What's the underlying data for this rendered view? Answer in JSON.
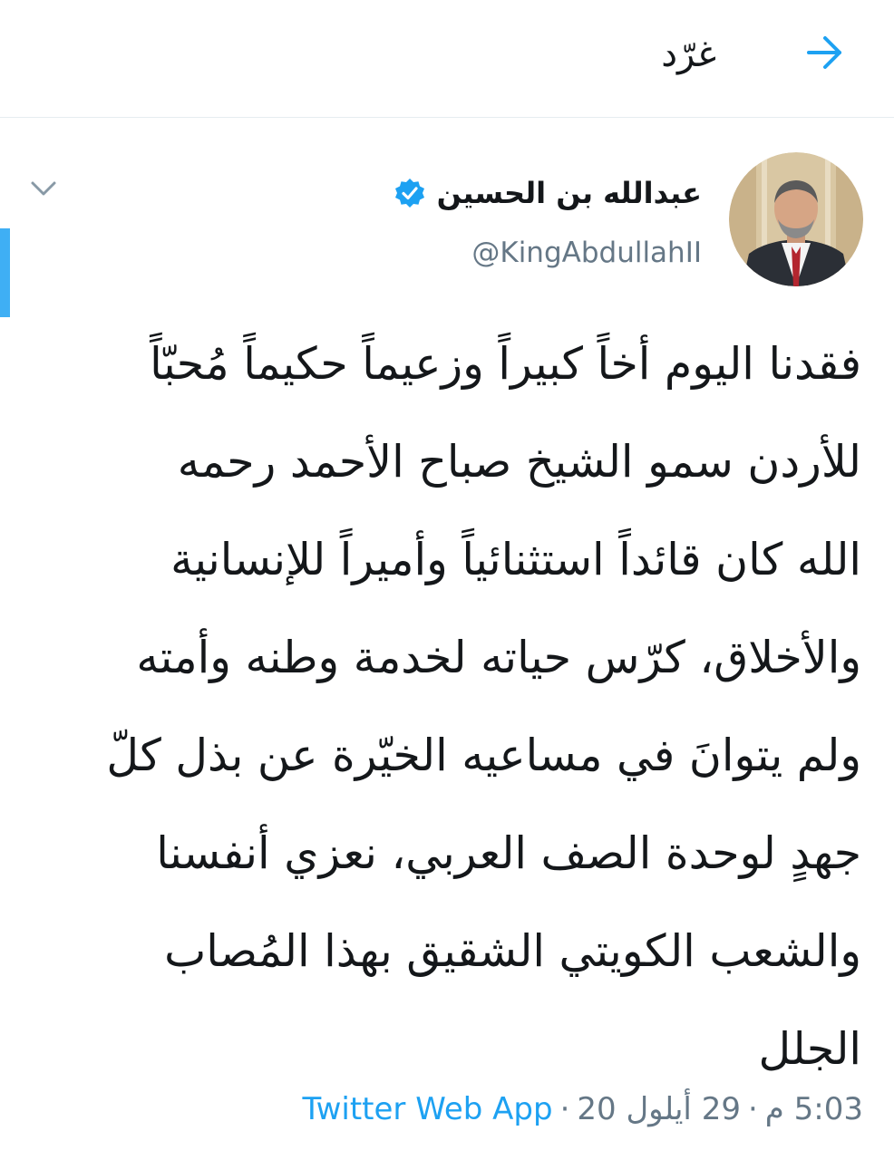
{
  "header": {
    "title": "غرّد",
    "back_icon": "arrow-right-icon"
  },
  "tweet": {
    "author": {
      "name": "عبدالله بن الحسين",
      "handle": "@KingAbdullahII",
      "verified": true
    },
    "text_lines": [
      "فقدنا اليوم أخاً كبيراً وزعيماً حكيماً مُحبّاً",
      "للأردن سمو الشيخ صباح الأحمد رحمه",
      "الله كان قائداً استثنائياً وأميراً للإنسانية",
      "والأخلاق، كرّس حياته لخدمة وطنه وأمته",
      "ولم يتوانَ في مساعيه الخيّرة عن بذل كلّ",
      "جهدٍ لوحدة الصف العربي، نعزي أنفسنا",
      "والشعب الكويتي الشقيق بهذا المُصاب",
      "الجلل"
    ],
    "time": "5:03 م",
    "date": "29 أيلول 20",
    "separator": "·",
    "source": "Twitter Web App"
  },
  "colors": {
    "accent": "#1da1f2",
    "text": "#14171a",
    "secondary": "#657786",
    "divider": "#e6ecf0"
  }
}
